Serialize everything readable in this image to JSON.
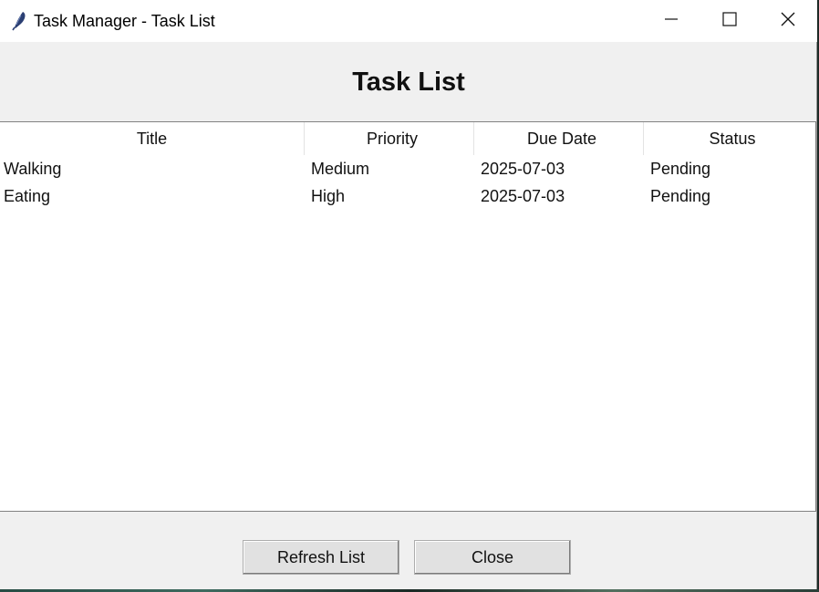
{
  "window": {
    "title": "Task Manager - Task List",
    "icon": "feather-icon",
    "controls": [
      "minimize-icon",
      "maximize-icon",
      "close-icon"
    ]
  },
  "header": {
    "title": "Task List"
  },
  "table": {
    "columns": [
      "Title",
      "Priority",
      "Due Date",
      "Status"
    ],
    "rows": [
      {
        "title": "Walking",
        "priority": "Medium",
        "due_date": "2025-07-03",
        "status": "Pending"
      },
      {
        "title": "Eating",
        "priority": "High",
        "due_date": "2025-07-03",
        "status": "Pending"
      }
    ]
  },
  "buttons": {
    "refresh_label": "Refresh List",
    "close_label": "Close"
  }
}
